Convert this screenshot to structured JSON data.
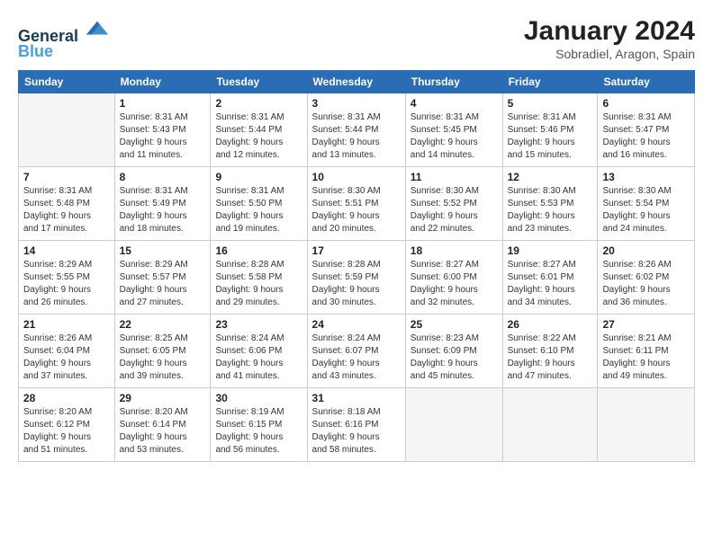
{
  "logo": {
    "line1": "General",
    "line2": "Blue"
  },
  "title": "January 2024",
  "subtitle": "Sobradiel, Aragon, Spain",
  "days_of_week": [
    "Sunday",
    "Monday",
    "Tuesday",
    "Wednesday",
    "Thursday",
    "Friday",
    "Saturday"
  ],
  "weeks": [
    [
      {
        "day": "",
        "info": ""
      },
      {
        "day": "1",
        "info": "Sunrise: 8:31 AM\nSunset: 5:43 PM\nDaylight: 9 hours\nand 11 minutes."
      },
      {
        "day": "2",
        "info": "Sunrise: 8:31 AM\nSunset: 5:44 PM\nDaylight: 9 hours\nand 12 minutes."
      },
      {
        "day": "3",
        "info": "Sunrise: 8:31 AM\nSunset: 5:44 PM\nDaylight: 9 hours\nand 13 minutes."
      },
      {
        "day": "4",
        "info": "Sunrise: 8:31 AM\nSunset: 5:45 PM\nDaylight: 9 hours\nand 14 minutes."
      },
      {
        "day": "5",
        "info": "Sunrise: 8:31 AM\nSunset: 5:46 PM\nDaylight: 9 hours\nand 15 minutes."
      },
      {
        "day": "6",
        "info": "Sunrise: 8:31 AM\nSunset: 5:47 PM\nDaylight: 9 hours\nand 16 minutes."
      }
    ],
    [
      {
        "day": "7",
        "info": "Sunrise: 8:31 AM\nSunset: 5:48 PM\nDaylight: 9 hours\nand 17 minutes."
      },
      {
        "day": "8",
        "info": "Sunrise: 8:31 AM\nSunset: 5:49 PM\nDaylight: 9 hours\nand 18 minutes."
      },
      {
        "day": "9",
        "info": "Sunrise: 8:31 AM\nSunset: 5:50 PM\nDaylight: 9 hours\nand 19 minutes."
      },
      {
        "day": "10",
        "info": "Sunrise: 8:30 AM\nSunset: 5:51 PM\nDaylight: 9 hours\nand 20 minutes."
      },
      {
        "day": "11",
        "info": "Sunrise: 8:30 AM\nSunset: 5:52 PM\nDaylight: 9 hours\nand 22 minutes."
      },
      {
        "day": "12",
        "info": "Sunrise: 8:30 AM\nSunset: 5:53 PM\nDaylight: 9 hours\nand 23 minutes."
      },
      {
        "day": "13",
        "info": "Sunrise: 8:30 AM\nSunset: 5:54 PM\nDaylight: 9 hours\nand 24 minutes."
      }
    ],
    [
      {
        "day": "14",
        "info": "Sunrise: 8:29 AM\nSunset: 5:55 PM\nDaylight: 9 hours\nand 26 minutes."
      },
      {
        "day": "15",
        "info": "Sunrise: 8:29 AM\nSunset: 5:57 PM\nDaylight: 9 hours\nand 27 minutes."
      },
      {
        "day": "16",
        "info": "Sunrise: 8:28 AM\nSunset: 5:58 PM\nDaylight: 9 hours\nand 29 minutes."
      },
      {
        "day": "17",
        "info": "Sunrise: 8:28 AM\nSunset: 5:59 PM\nDaylight: 9 hours\nand 30 minutes."
      },
      {
        "day": "18",
        "info": "Sunrise: 8:27 AM\nSunset: 6:00 PM\nDaylight: 9 hours\nand 32 minutes."
      },
      {
        "day": "19",
        "info": "Sunrise: 8:27 AM\nSunset: 6:01 PM\nDaylight: 9 hours\nand 34 minutes."
      },
      {
        "day": "20",
        "info": "Sunrise: 8:26 AM\nSunset: 6:02 PM\nDaylight: 9 hours\nand 36 minutes."
      }
    ],
    [
      {
        "day": "21",
        "info": "Sunrise: 8:26 AM\nSunset: 6:04 PM\nDaylight: 9 hours\nand 37 minutes."
      },
      {
        "day": "22",
        "info": "Sunrise: 8:25 AM\nSunset: 6:05 PM\nDaylight: 9 hours\nand 39 minutes."
      },
      {
        "day": "23",
        "info": "Sunrise: 8:24 AM\nSunset: 6:06 PM\nDaylight: 9 hours\nand 41 minutes."
      },
      {
        "day": "24",
        "info": "Sunrise: 8:24 AM\nSunset: 6:07 PM\nDaylight: 9 hours\nand 43 minutes."
      },
      {
        "day": "25",
        "info": "Sunrise: 8:23 AM\nSunset: 6:09 PM\nDaylight: 9 hours\nand 45 minutes."
      },
      {
        "day": "26",
        "info": "Sunrise: 8:22 AM\nSunset: 6:10 PM\nDaylight: 9 hours\nand 47 minutes."
      },
      {
        "day": "27",
        "info": "Sunrise: 8:21 AM\nSunset: 6:11 PM\nDaylight: 9 hours\nand 49 minutes."
      }
    ],
    [
      {
        "day": "28",
        "info": "Sunrise: 8:20 AM\nSunset: 6:12 PM\nDaylight: 9 hours\nand 51 minutes."
      },
      {
        "day": "29",
        "info": "Sunrise: 8:20 AM\nSunset: 6:14 PM\nDaylight: 9 hours\nand 53 minutes."
      },
      {
        "day": "30",
        "info": "Sunrise: 8:19 AM\nSunset: 6:15 PM\nDaylight: 9 hours\nand 56 minutes."
      },
      {
        "day": "31",
        "info": "Sunrise: 8:18 AM\nSunset: 6:16 PM\nDaylight: 9 hours\nand 58 minutes."
      },
      {
        "day": "",
        "info": ""
      },
      {
        "day": "",
        "info": ""
      },
      {
        "day": "",
        "info": ""
      }
    ]
  ]
}
